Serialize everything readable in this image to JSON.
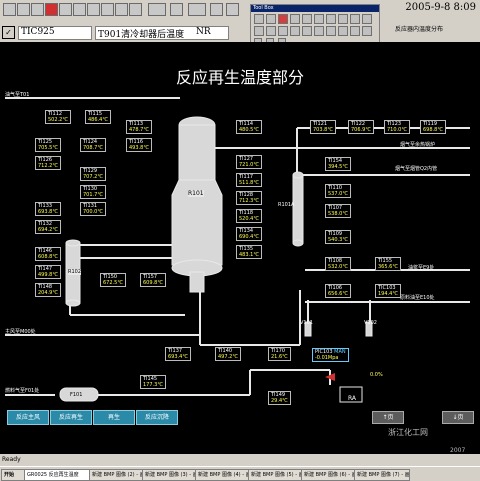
{
  "window": {
    "datetime": "2005-9-8 8:09",
    "tag": "TIC925",
    "tag_desc": "T901清冷却器后温度",
    "mode": "NR",
    "subtitle": "反应器内温度分布"
  },
  "toolbox": {
    "title": "Tool Box"
  },
  "main_title": "反应再生温度部分",
  "labels": {
    "top_left": "油气至T01",
    "smoke_boiler": "烟气至余热锅炉",
    "smoke_pipe": "烟气至烟管Q2内管",
    "oil_slurry": "油浆至E9处",
    "raw_oil": "原料油至E10处",
    "main_air": "主风至M00处",
    "fuel_gas": "燃料气至F01处",
    "r101": "R101",
    "r101a": "R101A",
    "r102": "R102",
    "f101": "F101",
    "v101": "V101",
    "v102": "V102",
    "pct": "0.0%",
    "ra": "RA",
    "watermark1": "浙江化工网",
    "watermark2": "2007"
  },
  "tags": [
    {
      "id": "TI112",
      "value": "502.2℃"
    },
    {
      "id": "TI115",
      "value": "486.4℃"
    },
    {
      "id": "TI113",
      "value": "478.7℃"
    },
    {
      "id": "TI116",
      "value": "493.8℃"
    },
    {
      "id": "TI125",
      "value": "705.5℃"
    },
    {
      "id": "TI124",
      "value": "708.7℃"
    },
    {
      "id": "TI126",
      "value": "712.2℃"
    },
    {
      "id": "TI129",
      "value": "707.2℃"
    },
    {
      "id": "TI130",
      "value": "701.7℃"
    },
    {
      "id": "TI133",
      "value": "693.8℃"
    },
    {
      "id": "TI131",
      "value": "700.0℃"
    },
    {
      "id": "TI132",
      "value": "694.2℃"
    },
    {
      "id": "TI146",
      "value": "608.8℃"
    },
    {
      "id": "TI147",
      "value": "499.8℃"
    },
    {
      "id": "TI148",
      "value": "204.9℃"
    },
    {
      "id": "TI150",
      "value": "672.5℃"
    },
    {
      "id": "TI157",
      "value": "609.8℃"
    },
    {
      "id": "TI114",
      "value": "480.5℃"
    },
    {
      "id": "TI127",
      "value": "721.0℃"
    },
    {
      "id": "TI117",
      "value": "511.8℃"
    },
    {
      "id": "TI128",
      "value": "712.3℃"
    },
    {
      "id": "TI118",
      "value": "520.4℃"
    },
    {
      "id": "TI134",
      "value": "690.4℃"
    },
    {
      "id": "TI135",
      "value": "483.1℃"
    },
    {
      "id": "TI121",
      "value": "703.8℃"
    },
    {
      "id": "TI122",
      "value": "706.9℃"
    },
    {
      "id": "TI123",
      "value": "710.0℃"
    },
    {
      "id": "TI119",
      "value": "698.8℃"
    },
    {
      "id": "TI154",
      "value": "394.5℃"
    },
    {
      "id": "TI110",
      "value": "537.0℃"
    },
    {
      "id": "TI107",
      "value": "538.0℃"
    },
    {
      "id": "TI109",
      "value": "540.3℃"
    },
    {
      "id": "TI108",
      "value": "532.0℃"
    },
    {
      "id": "TI155",
      "value": "365.6℃"
    },
    {
      "id": "TI106",
      "value": "656.6℃"
    },
    {
      "id": "TIC103",
      "value": "194.4℃"
    },
    {
      "id": "TI137",
      "value": "693.4℃"
    },
    {
      "id": "TI140",
      "value": "497.2℃"
    },
    {
      "id": "TI170",
      "value": "21.6℃"
    },
    {
      "id": "TI145",
      "value": "177.3℃"
    },
    {
      "id": "TI149",
      "value": "29.4℃"
    }
  ],
  "pic": {
    "id": "PIC103",
    "mode": "MAN",
    "value": "-0.01Mpa"
  },
  "nav_buttons": [
    "反应主风",
    "反应再生",
    "再生",
    "反应沉降"
  ],
  "page_buttons": [
    "↑页",
    "↓页"
  ],
  "status": "Ready",
  "taskbar": {
    "start": "开始",
    "items": [
      "GR0025 反应再生温度",
      "新建 BMP 图像 (2) - 画图",
      "新建 BMP 图像 (3) - 画图",
      "新建 BMP 图像 (4) - 画图",
      "新建 BMP 图像 (5) - 画图",
      "新建 BMP 图像 (6) - 画图",
      "新建 BMP 图像 (7) - 画图"
    ]
  },
  "colors": {
    "pipe": "#e8e8e8",
    "tag_value": "#ffff55",
    "nav_button": "#2a8aa8"
  }
}
